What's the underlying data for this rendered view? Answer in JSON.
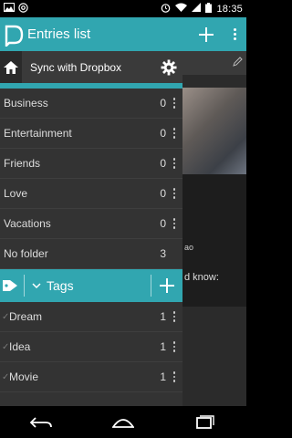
{
  "status_bar": {
    "time": "18:35",
    "left_icons": [
      "image-icon",
      "at-sign-icon"
    ],
    "right_icons": [
      "alarm-icon",
      "wifi-icon",
      "signal-icon",
      "battery-icon"
    ]
  },
  "appbar": {
    "title": "Entries list",
    "add_icon": "plus-icon",
    "menu_icon": "overflow-menu-icon"
  },
  "drawer": {
    "sync_label": "Sync with Dropbox",
    "folders": [
      {
        "label": "Business",
        "count": "0",
        "menu": true
      },
      {
        "label": "Entertainment",
        "count": "0",
        "menu": true
      },
      {
        "label": "Friends",
        "count": "0",
        "menu": true
      },
      {
        "label": "Love",
        "count": "0",
        "menu": true
      },
      {
        "label": "Vacations",
        "count": "0",
        "menu": true
      },
      {
        "label": "No folder",
        "count": "3",
        "menu": false
      }
    ],
    "tags_title": "Tags",
    "tags": [
      {
        "label": "Dream",
        "count": "1"
      },
      {
        "label": "Idea",
        "count": "1"
      },
      {
        "label": "Movie",
        "count": "1"
      }
    ]
  },
  "background": {
    "text1": "ao",
    "text2": "d know:"
  },
  "colors": {
    "accent": "#31a6b0",
    "drawer_bg": "#333333"
  }
}
